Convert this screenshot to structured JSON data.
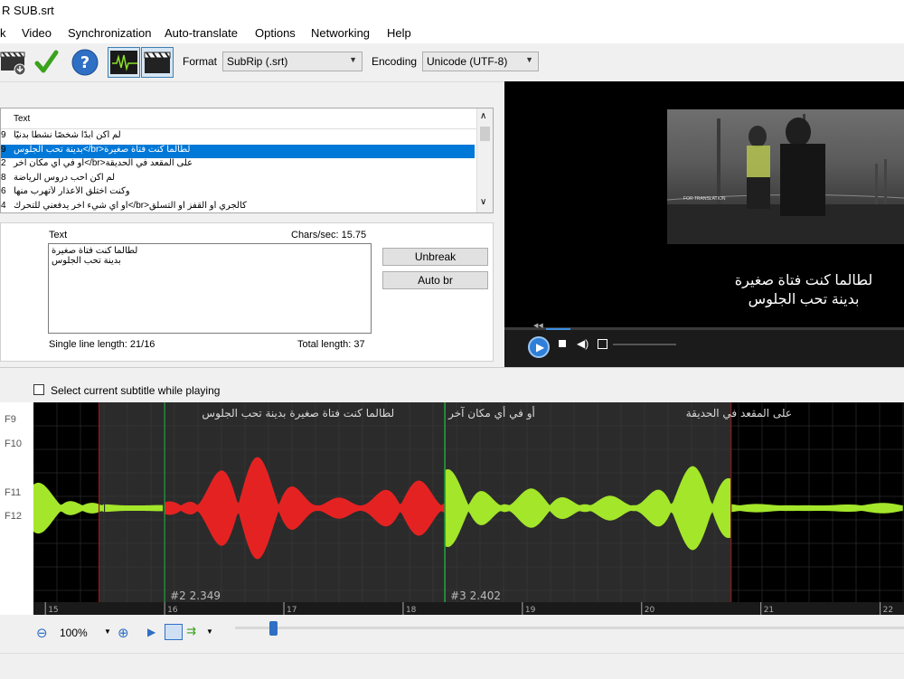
{
  "window": {
    "title": "R SUB.srt"
  },
  "menu": [
    "k",
    "Video",
    "Synchronization",
    "Auto-translate",
    "Options",
    "Networking",
    "Help"
  ],
  "toolbar": {
    "format_label": "Format",
    "format_value": "SubRip (.srt)",
    "encoding_label": "Encoding",
    "encoding_value": "Unicode (UTF-8)"
  },
  "grid": {
    "header_text": "Text",
    "rows": [
      {
        "num": "9",
        "text": "لم أكن أبدًا شخصًا نشطًا بدنيًا",
        "selected": false
      },
      {
        "num": "9",
        "text": "بدينة تحب الجلوس</br>لطالما كنت فتاة صغيرة",
        "selected": true
      },
      {
        "num": "2",
        "text": "أو في أي مكان آخر</br>على المقعد في الحديقة",
        "selected": false
      },
      {
        "num": "8",
        "text": "لم أكن أحب دروس الرياضة",
        "selected": false
      },
      {
        "num": "6",
        "text": "وكنت أختلق الأعذار لأتهرب منها",
        "selected": false
      },
      {
        "num": "4",
        "text": "أو أي شيء آخر يدفعني للتحرك</br>كالجري أو القفز أو التسلق",
        "selected": false
      }
    ]
  },
  "editor": {
    "text_label": "Text",
    "chars_sec": "Chars/sec: 15.75",
    "line1": "لطالما كنت فتاة صغيرة",
    "line2": "بدينة تحب الجلوس",
    "unbreak": "Unbreak",
    "auto_br": "Auto br",
    "single_line": "Single line length: 21/16",
    "total_length": "Total length: 37"
  },
  "video": {
    "frame_text": "FOR TRANSLATION",
    "sub_line1": "لطالما كنت فتاة صغيرة",
    "sub_line2": "بدينة تحب الجلوس",
    "progress": 0.06
  },
  "waveform": {
    "checkbox_label": "Select current subtitle while playing",
    "shortcuts": [
      "F9",
      "F10",
      "F11",
      "F12"
    ],
    "segments": [
      {
        "text": "لطالما كنت فتاة صغيرة  بدينة تحب الجلوس",
        "label": "#2  2.349",
        "color": "#e52222",
        "start": 16.0,
        "end": 18.35
      },
      {
        "text": "أو في أي مكان آخر",
        "label": "#3  2.402",
        "color": "#a4e62a",
        "start": 18.35,
        "end": 20.75
      }
    ],
    "segment3_text": "على المقعد في الحديقة",
    "ticks": [
      "15",
      "16",
      "17",
      "18",
      "19",
      "20",
      "21",
      "22"
    ],
    "view_start": 14.9,
    "view_end": 22.2
  },
  "wave_toolbar": {
    "zoom": "100%"
  }
}
